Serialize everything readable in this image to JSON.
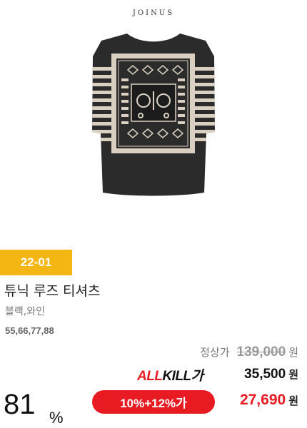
{
  "brand": {
    "logo_text": "JOINUS"
  },
  "product": {
    "image_icon": "striped-tshirt-image",
    "season_badge": "22-01",
    "name": "튜닉 루즈 티셔츠",
    "colors": "블랙,와인",
    "sizes": "55,66,77,88"
  },
  "pricing": {
    "regular_label": "정상가",
    "regular_price": "139,000",
    "currency": "원",
    "allkill_logo_a": "ALL",
    "allkill_logo_k": "KILL가",
    "allkill_price": "35,500",
    "coupon_label": "10%+12%가",
    "final_price": "27,690",
    "discount_rate": "81",
    "discount_unit": "%"
  },
  "colors": {
    "badge": "#f3b613",
    "accent_red": "#e81b23",
    "shirt_black": "#2b2b2b",
    "shirt_beige": "#d9d0c1"
  }
}
